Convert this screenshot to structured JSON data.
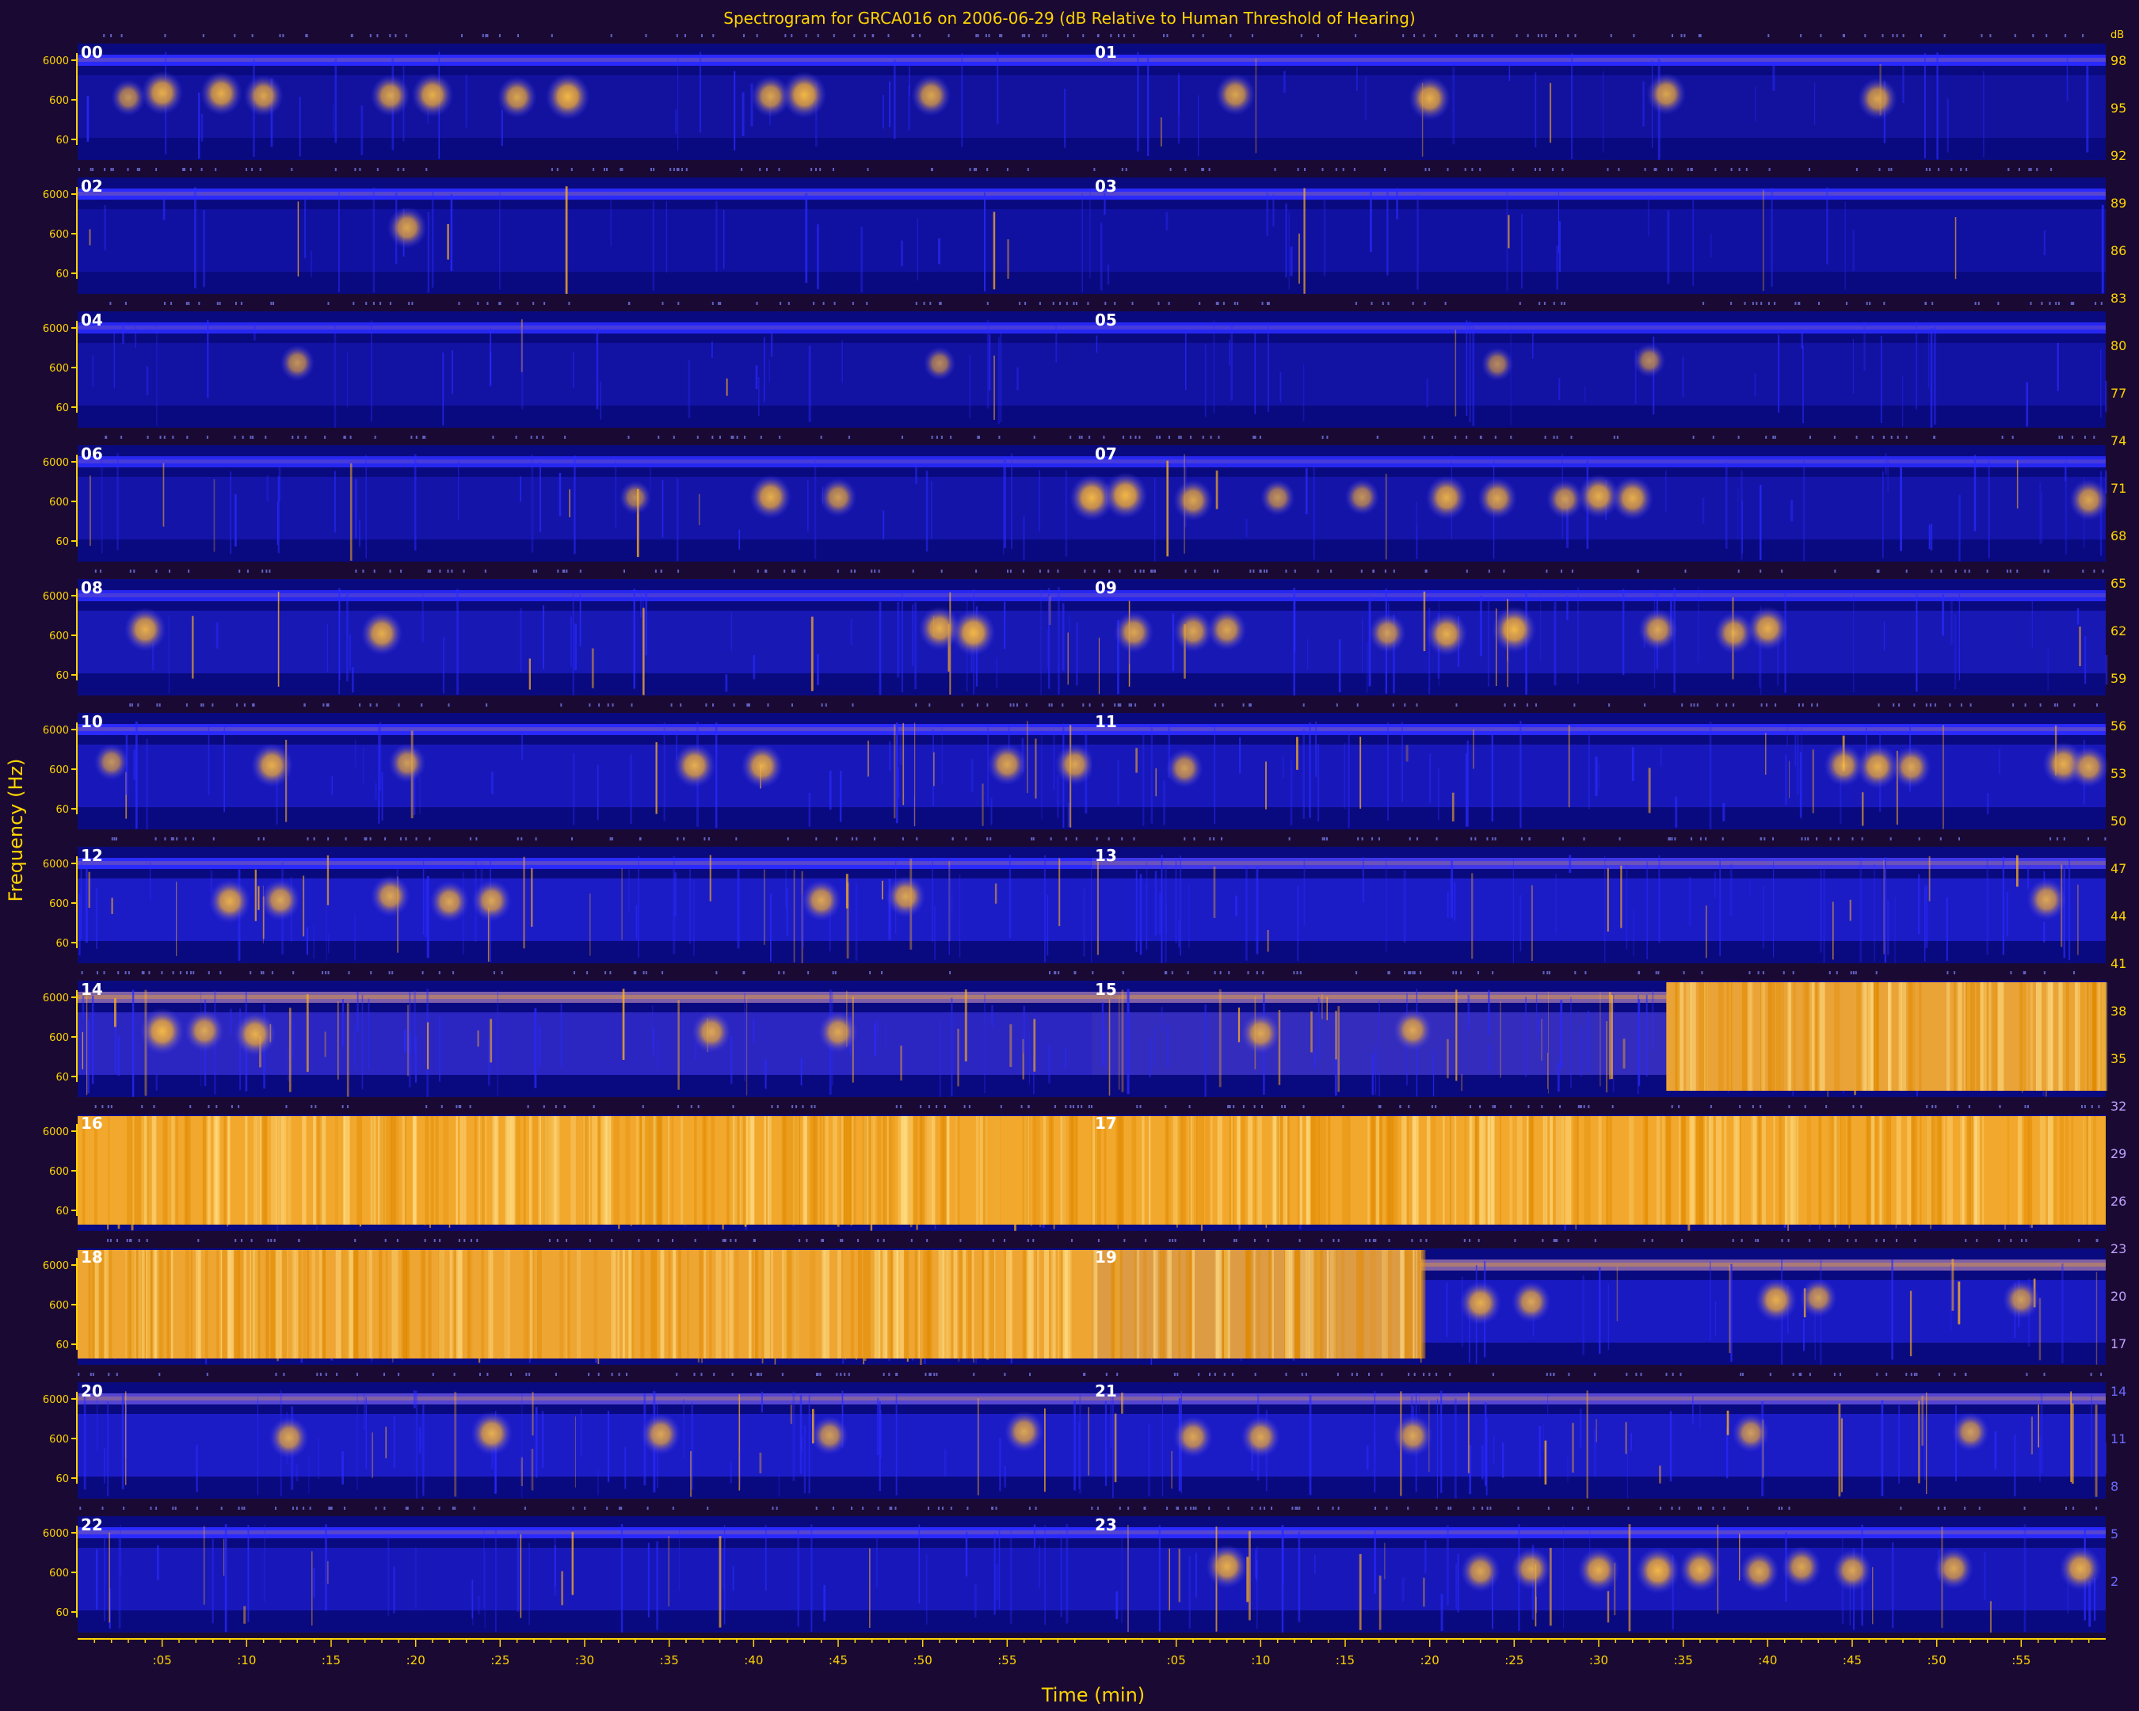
{
  "chart_data": {
    "type": "heatmap",
    "title": "Spectrogram for GRCA016 on 2006-06-29 (dB Relative to Human Threshold of Hearing)",
    "xlabel": "Time (min)",
    "ylabel": "Frequency (Hz)",
    "x_tick_labels": [
      ":05",
      ":10",
      ":15",
      ":20",
      ":25",
      ":30",
      ":35",
      ":40",
      ":45",
      ":50",
      ":55"
    ],
    "y_tick_labels": [
      "6000",
      "600",
      "60"
    ],
    "colorbar_unit": "dB",
    "colorbar_ticks": [
      98,
      95,
      92,
      89,
      86,
      83,
      80,
      77,
      74,
      71,
      68,
      65,
      62,
      59,
      56,
      53,
      50,
      47,
      44,
      41,
      38,
      35,
      32,
      29,
      26,
      23,
      20,
      17,
      14,
      11,
      8,
      5,
      2
    ],
    "colors": {
      "background": "#1a0a33",
      "accent": "#ffd400",
      "low": "#0a0a80",
      "mid": "#2a2aff",
      "high": "#ffb020"
    },
    "hour_labels": [
      "00",
      "01",
      "02",
      "03",
      "04",
      "05",
      "06",
      "07",
      "08",
      "09",
      "10",
      "11",
      "12",
      "13",
      "14",
      "15",
      "16",
      "17",
      "18",
      "19",
      "20",
      "21",
      "22",
      "23"
    ],
    "panels": [
      {
        "hour": "00",
        "band": 0.5,
        "noise": 0.1,
        "events": [
          [
            3,
            0.2
          ],
          [
            5,
            0.35
          ],
          [
            8.5,
            0.35
          ],
          [
            11,
            0.3
          ],
          [
            18.5,
            0.3
          ],
          [
            21,
            0.35
          ],
          [
            26,
            0.3
          ],
          [
            29,
            0.4
          ],
          [
            41,
            0.3
          ],
          [
            43,
            0.4
          ],
          [
            50.5,
            0.3
          ]
        ]
      },
      {
        "hour": "01",
        "band": 0.5,
        "noise": 0.1,
        "events": [
          [
            8.5,
            0.3
          ],
          [
            20,
            0.35
          ],
          [
            34,
            0.3
          ],
          [
            46.5,
            0.3
          ]
        ]
      },
      {
        "hour": "02",
        "band": 0.5,
        "noise": 0.12,
        "events": [
          [
            19.5,
            0.3
          ]
        ]
      },
      {
        "hour": "03",
        "band": 0.5,
        "noise": 0.12,
        "events": []
      },
      {
        "hour": "04",
        "band": 0.45,
        "noise": 0.15,
        "events": [
          [
            13,
            0.2
          ],
          [
            51,
            0.15
          ]
        ]
      },
      {
        "hour": "05",
        "band": 0.45,
        "noise": 0.15,
        "events": [
          [
            24,
            0.15
          ],
          [
            33,
            0.15
          ]
        ]
      },
      {
        "hour": "06",
        "band": 0.45,
        "noise": 0.2,
        "events": [
          [
            33,
            0.15
          ],
          [
            41,
            0.35
          ],
          [
            45,
            0.25
          ]
        ]
      },
      {
        "hour": "07",
        "band": 0.45,
        "noise": 0.2,
        "events": [
          [
            0,
            0.4
          ],
          [
            2,
            0.4
          ],
          [
            6,
            0.3
          ],
          [
            11,
            0.2
          ],
          [
            16,
            0.2
          ],
          [
            21,
            0.35
          ],
          [
            24,
            0.3
          ],
          [
            28,
            0.25
          ],
          [
            30,
            0.35
          ],
          [
            32,
            0.35
          ],
          [
            59,
            0.3
          ]
        ]
      },
      {
        "hour": "08",
        "band": 0.45,
        "noise": 0.3,
        "events": [
          [
            4,
            0.35
          ],
          [
            18,
            0.35
          ],
          [
            51,
            0.35
          ],
          [
            53,
            0.4
          ]
        ]
      },
      {
        "hour": "09",
        "band": 0.45,
        "noise": 0.3,
        "events": [
          [
            2.5,
            0.3
          ],
          [
            6,
            0.3
          ],
          [
            8,
            0.3
          ],
          [
            17.5,
            0.25
          ],
          [
            21,
            0.35
          ],
          [
            25,
            0.4
          ],
          [
            33.5,
            0.3
          ],
          [
            38,
            0.3
          ],
          [
            40,
            0.35
          ]
        ]
      },
      {
        "hour": "10",
        "band": 0.5,
        "noise": 0.35,
        "events": [
          [
            2,
            0.2
          ],
          [
            11.5,
            0.35
          ],
          [
            19.5,
            0.25
          ],
          [
            36.5,
            0.35
          ],
          [
            40.5,
            0.35
          ],
          [
            55,
            0.3
          ],
          [
            59,
            0.3
          ]
        ]
      },
      {
        "hour": "11",
        "band": 0.5,
        "noise": 0.35,
        "events": [
          [
            5.5,
            0.25
          ],
          [
            44.5,
            0.3
          ],
          [
            46.5,
            0.35
          ],
          [
            48.5,
            0.3
          ],
          [
            57.5,
            0.35
          ],
          [
            59,
            0.3
          ]
        ]
      },
      {
        "hour": "12",
        "band": 0.5,
        "noise": 0.45,
        "events": [
          [
            9,
            0.35
          ],
          [
            12,
            0.3
          ],
          [
            18.5,
            0.3
          ],
          [
            22,
            0.3
          ],
          [
            24.5,
            0.3
          ],
          [
            44,
            0.3
          ],
          [
            49,
            0.3
          ]
        ]
      },
      {
        "hour": "13",
        "band": 0.55,
        "noise": 0.45,
        "events": [
          [
            56.5,
            0.3
          ]
        ]
      },
      {
        "hour": "14",
        "band": 0.7,
        "noise": 0.55,
        "events": [
          [
            5,
            0.4
          ],
          [
            7.5,
            0.3
          ],
          [
            10.5,
            0.35
          ],
          [
            37.5,
            0.3
          ],
          [
            45,
            0.3
          ]
        ]
      },
      {
        "hour": "15",
        "band": 0.7,
        "noise": 0.6,
        "events": [
          [
            10,
            0.3
          ],
          [
            19,
            0.3
          ]
        ],
        "full": [
          [
            34,
            60,
            0.95
          ]
        ]
      },
      {
        "hour": "16",
        "band": 0.95,
        "noise": 0.95,
        "events": [],
        "full": [
          [
            0,
            60,
            0.97
          ]
        ]
      },
      {
        "hour": "17",
        "band": 0.95,
        "noise": 0.95,
        "events": [],
        "full": [
          [
            0,
            60,
            0.97
          ]
        ]
      },
      {
        "hour": "18",
        "band": 0.95,
        "noise": 0.95,
        "events": [],
        "full": [
          [
            0,
            60,
            0.96
          ]
        ]
      },
      {
        "hour": "19",
        "band": 0.7,
        "noise": 0.4,
        "events": [
          [
            23,
            0.35
          ],
          [
            26,
            0.3
          ],
          [
            40.5,
            0.35
          ],
          [
            43,
            0.25
          ],
          [
            55,
            0.25
          ]
        ],
        "full": [
          [
            0,
            19.5,
            0.92
          ]
        ]
      },
      {
        "hour": "20",
        "band": 0.6,
        "noise": 0.45,
        "events": [
          [
            12.5,
            0.3
          ],
          [
            24.5,
            0.35
          ],
          [
            34.5,
            0.3
          ],
          [
            44.5,
            0.25
          ],
          [
            56,
            0.3
          ]
        ]
      },
      {
        "hour": "21",
        "band": 0.6,
        "noise": 0.45,
        "events": [
          [
            6,
            0.3
          ],
          [
            10,
            0.3
          ],
          [
            19,
            0.3
          ],
          [
            39,
            0.25
          ],
          [
            52,
            0.25
          ]
        ]
      },
      {
        "hour": "22",
        "band": 0.5,
        "noise": 0.35,
        "events": []
      },
      {
        "hour": "23",
        "band": 0.5,
        "noise": 0.35,
        "events": [
          [
            8,
            0.35
          ],
          [
            23,
            0.3
          ],
          [
            26,
            0.3
          ],
          [
            30,
            0.35
          ],
          [
            33.5,
            0.4
          ],
          [
            36,
            0.35
          ],
          [
            39.5,
            0.3
          ],
          [
            42,
            0.3
          ],
          [
            45,
            0.3
          ],
          [
            51,
            0.3
          ],
          [
            58.5,
            0.35
          ]
        ]
      }
    ]
  }
}
